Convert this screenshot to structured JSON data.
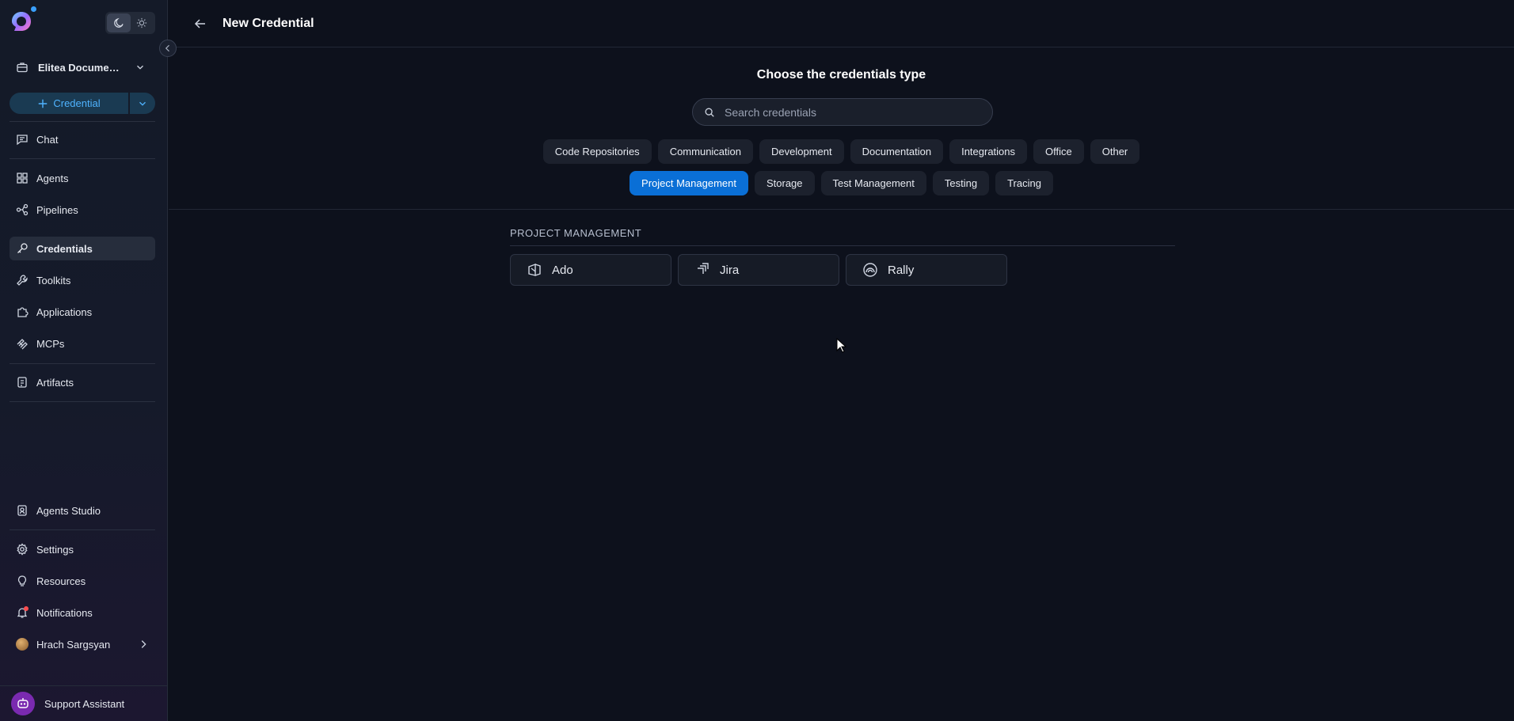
{
  "sidebar": {
    "project": "Elitea Documentation",
    "create_button": "Credential",
    "nav": {
      "chat": "Chat",
      "agents": "Agents",
      "pipelines": "Pipelines",
      "credentials": "Credentials",
      "toolkits": "Toolkits",
      "applications": "Applications",
      "mcps": "MCPs",
      "artifacts": "Artifacts",
      "agents_studio": "Agents Studio",
      "settings": "Settings",
      "resources": "Resources",
      "notifications": "Notifications",
      "user": "Hrach Sargsyan"
    },
    "support": "Support Assistant",
    "active_item": "Credentials"
  },
  "header": {
    "title": "New Credential"
  },
  "main": {
    "heading": "Choose the credentials type",
    "search_placeholder": "Search credentials",
    "categories": [
      "Code Repositories",
      "Communication",
      "Development",
      "Documentation",
      "Integrations",
      "Office",
      "Other",
      "Project Management",
      "Storage",
      "Test Management",
      "Testing",
      "Tracing"
    ],
    "selected_category": "Project Management",
    "section_title": "PROJECT MANAGEMENT",
    "credentials": [
      {
        "label": "Ado",
        "icon": "azure-devops-icon"
      },
      {
        "label": "Jira",
        "icon": "jira-icon"
      },
      {
        "label": "Rally",
        "icon": "rally-icon"
      }
    ]
  },
  "colors": {
    "accent": "#0a6fd6",
    "background": "#0d111c",
    "sidebar": "#151a2a",
    "create_button_text": "#4fb3ff"
  }
}
